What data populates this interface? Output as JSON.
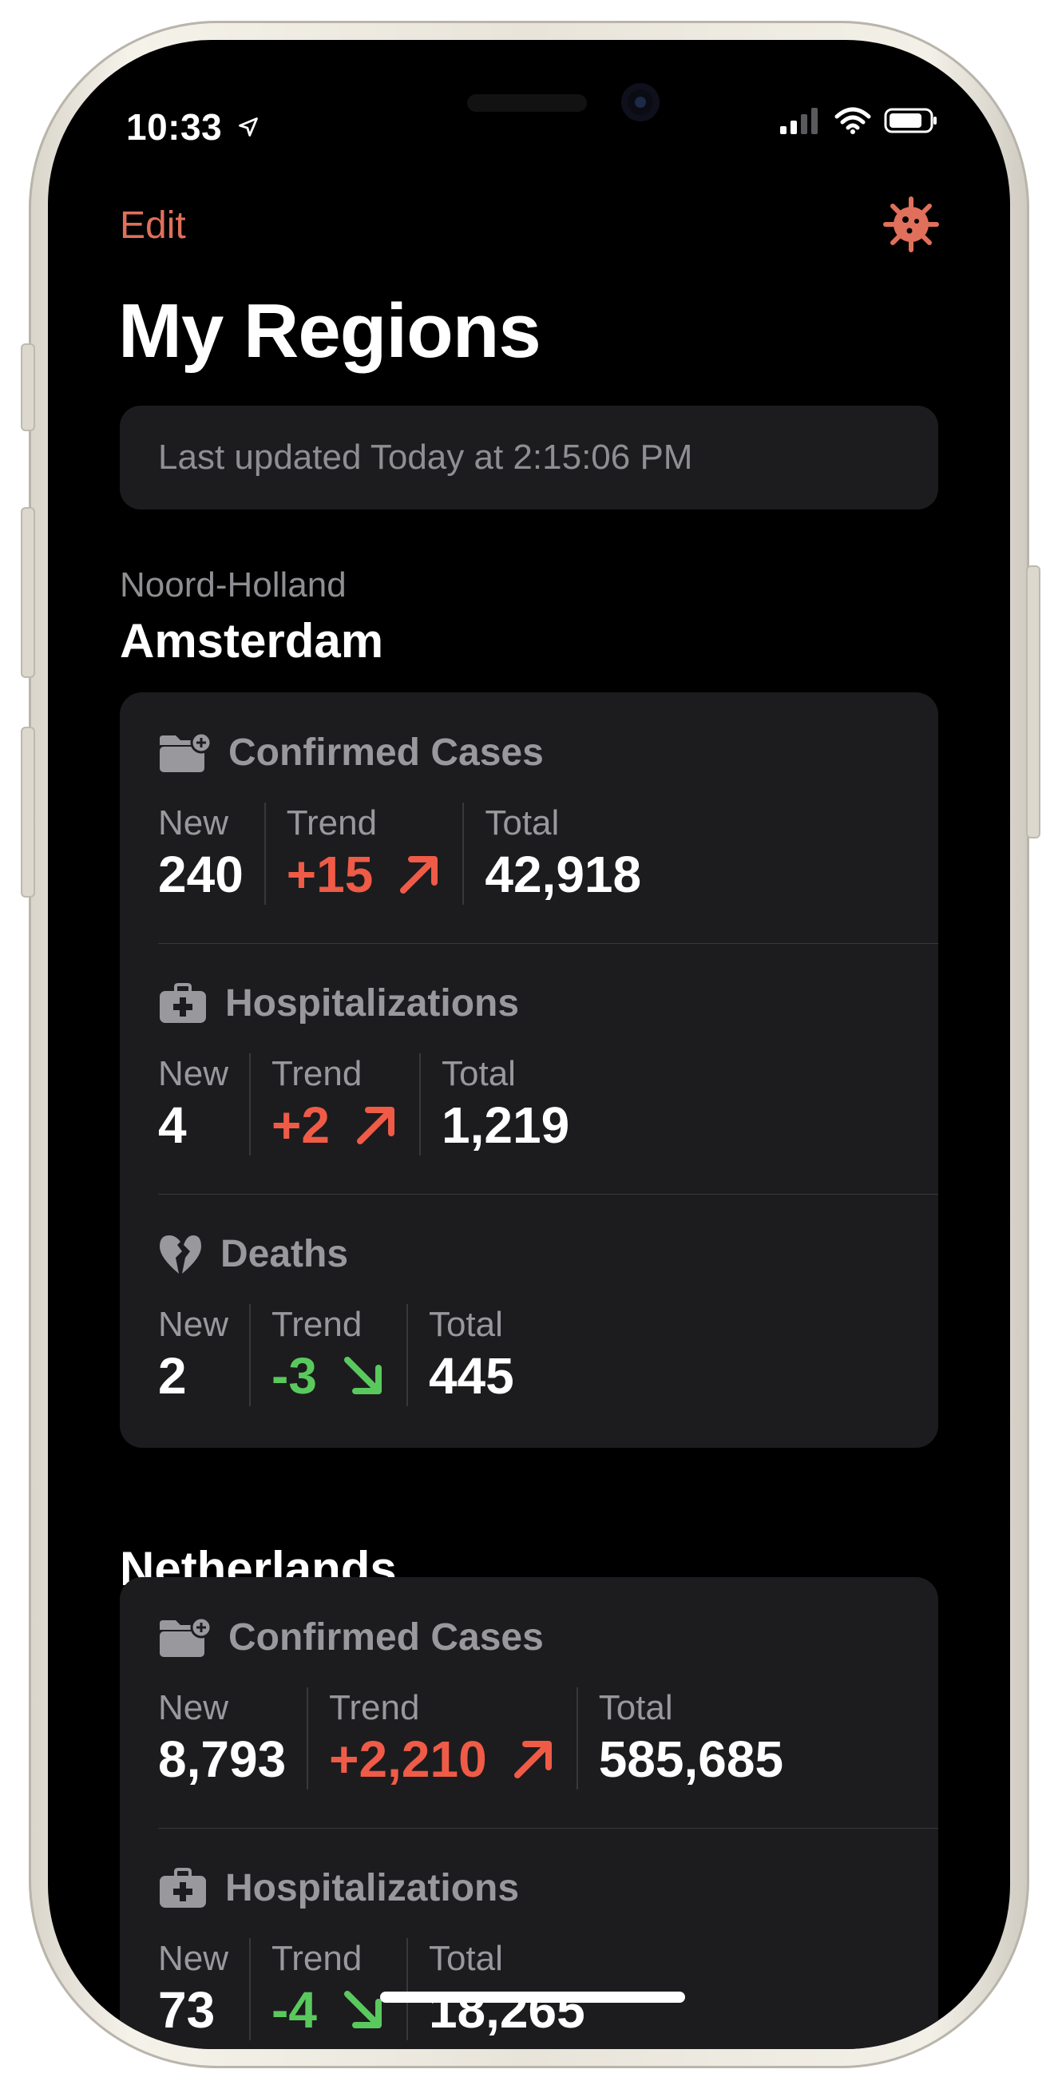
{
  "status_bar": {
    "time": "10:33"
  },
  "nav": {
    "edit_label": "Edit",
    "title": "My Regions"
  },
  "last_updated": "Last updated Today at 2:15:06 PM",
  "colors": {
    "accent": "#e0705b",
    "up": "#ef5b47",
    "down": "#5ac95d",
    "card": "#1c1c1e"
  },
  "regions": [
    {
      "subtitle": "Noord-Holland",
      "name": "Amsterdam",
      "metrics": [
        {
          "icon": "folder-plus-icon",
          "title": "Confirmed Cases",
          "new_label": "New",
          "new": "240",
          "trend_label": "Trend",
          "trend": "+15",
          "trend_direction": "up",
          "total_label": "Total",
          "total": "42,918"
        },
        {
          "icon": "medical-kit-icon",
          "title": "Hospitalizations",
          "new_label": "New",
          "new": "4",
          "trend_label": "Trend",
          "trend": "+2",
          "trend_direction": "up",
          "total_label": "Total",
          "total": "1,219"
        },
        {
          "icon": "broken-heart-icon",
          "title": "Deaths",
          "new_label": "New",
          "new": "2",
          "trend_label": "Trend",
          "trend": "-3",
          "trend_direction": "down",
          "total_label": "Total",
          "total": "445"
        }
      ]
    },
    {
      "name": "Netherlands",
      "metrics": [
        {
          "icon": "folder-plus-icon",
          "title": "Confirmed Cases",
          "new_label": "New",
          "new": "8,793",
          "trend_label": "Trend",
          "trend": "+2,210",
          "trend_direction": "up",
          "total_label": "Total",
          "total": "585,685"
        },
        {
          "icon": "medical-kit-icon",
          "title": "Hospitalizations",
          "new_label": "New",
          "new": "73",
          "trend_label": "Trend",
          "trend": "-4",
          "trend_direction": "down",
          "total_label": "Total",
          "total": "18,265"
        }
      ]
    }
  ]
}
